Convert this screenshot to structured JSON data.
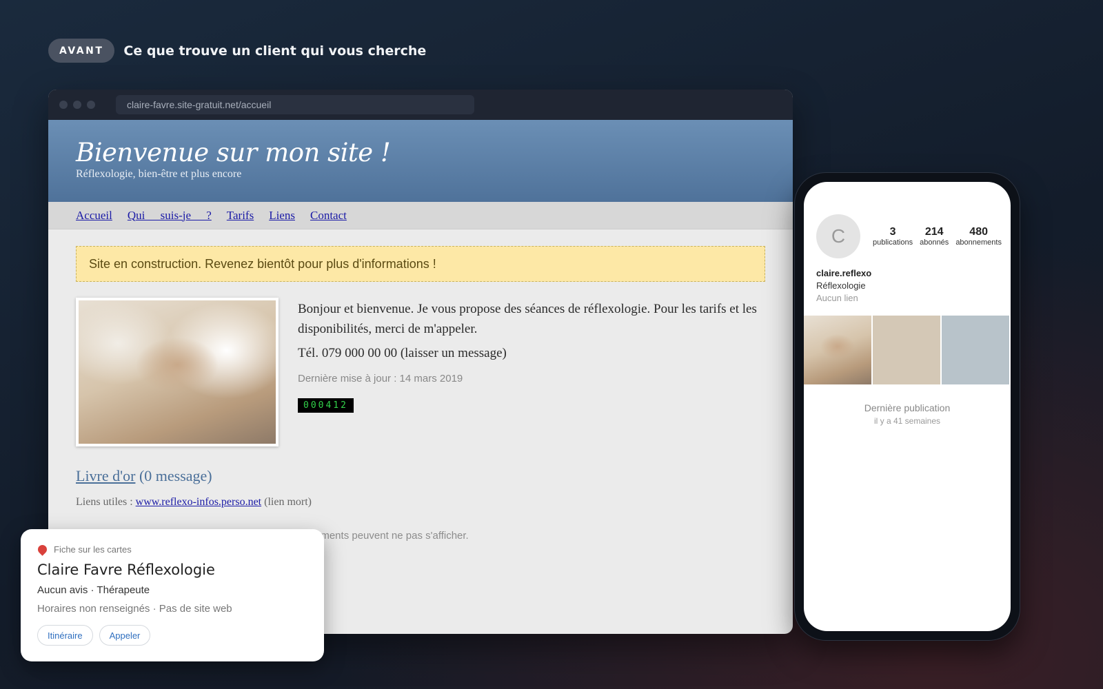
{
  "header": {
    "badge": "AVANT",
    "title": "Ce que trouve un client qui vous cherche"
  },
  "browser": {
    "url": "claire-favre.site-gratuit.net/accueil"
  },
  "site": {
    "title": "Bienvenue sur mon site !",
    "subtitle": "Réflexologie, bien-être et plus encore",
    "nav": [
      "Accueil",
      "Qui suis-je ?",
      "Tarifs",
      "Liens",
      "Contact"
    ],
    "notice": "Site en construction. Revenez bientôt pour plus d'informations !",
    "intro": "Bonjour et bienvenue. Je vous propose des séances de réflexologie. Pour les tarifs et les disponibilités, merci de m'appeler.",
    "tel": "Tél. 079 000 00 00 (laisser un message)",
    "updated": "Dernière mise à jour : 14 mars 2019",
    "counter": "000412",
    "guestbook_link": "Livre d'or",
    "guestbook_count": "(0 message)",
    "links_label": "Liens utiles :",
    "links_url": "www.reflexo-infos.perso.net",
    "links_status": "(lien mort)",
    "warning_tail": "éments peuvent ne pas s'afficher."
  },
  "phone": {
    "avatar_letter": "C",
    "stats": [
      {
        "num": "3",
        "label": "publications"
      },
      {
        "num": "214",
        "label": "abonnés"
      },
      {
        "num": "480",
        "label": "abonnements"
      }
    ],
    "username": "claire.reflexo",
    "category": "Réflexologie",
    "link": "Aucun lien",
    "last_post_title": "Dernière publication",
    "last_post_when": "il y a 41 semaines"
  },
  "map_card": {
    "label": "Fiche sur les cartes",
    "name": "Claire Favre Réflexologie",
    "meta": "Aucun avis · Thérapeute",
    "info": "Horaires non renseignés · Pas de site web",
    "buttons": [
      "Itinéraire",
      "Appeler"
    ]
  },
  "colors": {
    "site_header": "#5a7ea6",
    "notice_bg": "#fde8a6",
    "counter_text": "#32d24a",
    "map_pin": "#d9413b",
    "map_button_text": "#2f6fbf"
  },
  "icons": [
    "window-dot",
    "map-pin-icon",
    "avatar-placeholder"
  ]
}
